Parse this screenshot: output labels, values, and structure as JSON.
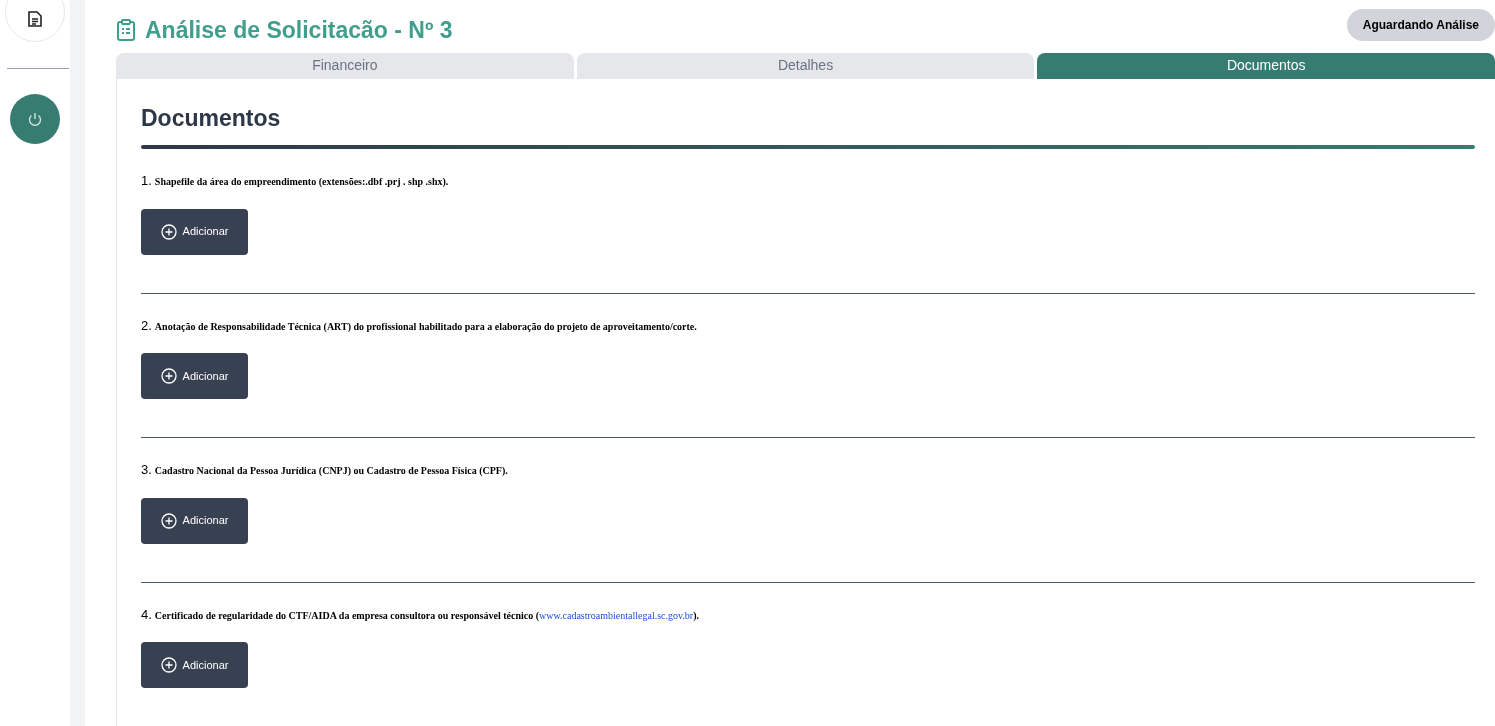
{
  "title": "Análise de Solicitacão - Nº 3",
  "status_badge": "Aguardando Análise",
  "tabs": [
    {
      "label": "Financeiro",
      "selected": false
    },
    {
      "label": "Detalhes",
      "selected": false
    },
    {
      "label": "Documentos",
      "selected": true
    }
  ],
  "section_title": "Documentos",
  "documents": [
    {
      "number": "1.",
      "text": "Shapefile da área do empreendimento (extensões:.dbf .prj . shp .shx).",
      "button": "Adicionar"
    },
    {
      "number": "2.",
      "text": "Anotação de Responsabilidade Técnica (ART) do profissional habilitado para a elaboração do projeto de aproveitamento/corte.",
      "button": "Adicionar"
    },
    {
      "number": "3.",
      "text": "Cadastro Nacional da Pessoa Jurídica (CNPJ) ou Cadastro de Pessoa Física (CPF).",
      "button": "Adicionar"
    },
    {
      "number": "4.",
      "text": "Certificado de regularidade do CTF/AIDA da empresa consultora ou responsável técnico (",
      "link": "www.cadastroambientallegal.sc.gov.br",
      "text_after": ").",
      "button": "Adicionar"
    }
  ]
}
